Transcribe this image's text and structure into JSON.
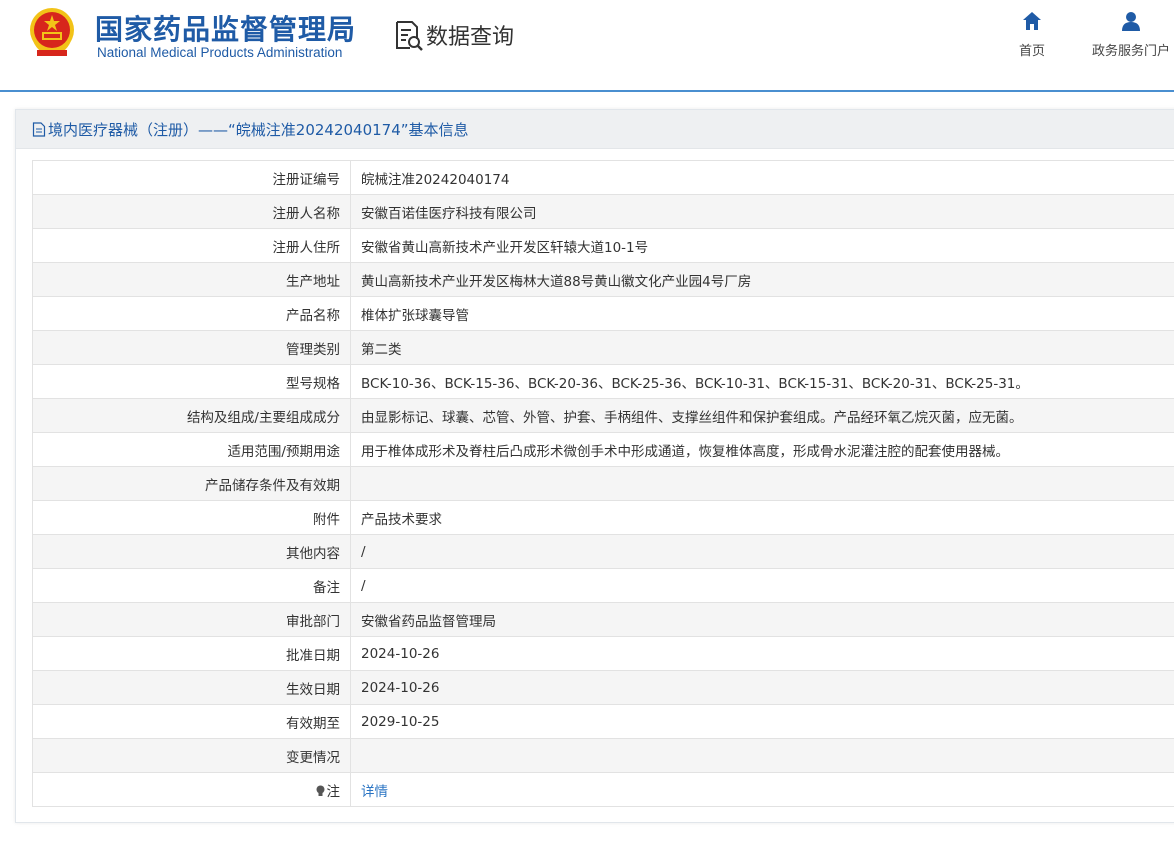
{
  "header": {
    "org_name_cn": "国家药品监督管理局",
    "org_name_en": "National Medical Products Administration",
    "query_label": "数据查询",
    "nav": [
      {
        "label": "首页",
        "icon": "home-icon"
      },
      {
        "label": "政务服务门户",
        "icon": "user-icon"
      }
    ]
  },
  "panel": {
    "title": "境内医疗器械（注册）——“皖械注准20242040174”基本信息"
  },
  "rows": [
    {
      "label": "注册证编号",
      "value": "皖械注准20242040174"
    },
    {
      "label": "注册人名称",
      "value": "安徽百诺佳医疗科技有限公司"
    },
    {
      "label": "注册人住所",
      "value": "安徽省黄山高新技术产业开发区轩辕大道10-1号"
    },
    {
      "label": "生产地址",
      "value": "黄山高新技术产业开发区梅林大道88号黄山徽文化产业园4号厂房"
    },
    {
      "label": "产品名称",
      "value": "椎体扩张球囊导管"
    },
    {
      "label": "管理类别",
      "value": "第二类"
    },
    {
      "label": "型号规格",
      "value": "BCK-10-36、BCK-15-36、BCK-20-36、BCK-25-36、BCK-10-31、BCK-15-31、BCK-20-31、BCK-25-31。"
    },
    {
      "label": "结构及组成/主要组成成分",
      "value": "由显影标记、球囊、芯管、外管、护套、手柄组件、支撑丝组件和保护套组成。产品经环氧乙烷灭菌，应无菌。"
    },
    {
      "label": "适用范围/预期用途",
      "value": "用于椎体成形术及脊柱后凸成形术微创手术中形成通道，恢复椎体高度，形成骨水泥灌注腔的配套使用器械。"
    },
    {
      "label": "产品储存条件及有效期",
      "value": ""
    },
    {
      "label": "附件",
      "value": "产品技术要求"
    },
    {
      "label": "其他内容",
      "value": "/"
    },
    {
      "label": "备注",
      "value": "/"
    },
    {
      "label": "审批部门",
      "value": "安徽省药品监督管理局"
    },
    {
      "label": "批准日期",
      "value": "2024-10-26"
    },
    {
      "label": "生效日期",
      "value": "2024-10-26"
    },
    {
      "label": "有效期至",
      "value": "2029-10-25"
    },
    {
      "label": "变更情况",
      "value": ""
    }
  ],
  "note": {
    "label": "注",
    "link": "详情",
    "icon": "bulb-icon"
  },
  "colors": {
    "brand_blue": "#1f5ba6",
    "link_blue": "#2a74c3",
    "emblem_red": "#d7261c",
    "emblem_gold": "#f2c318"
  }
}
